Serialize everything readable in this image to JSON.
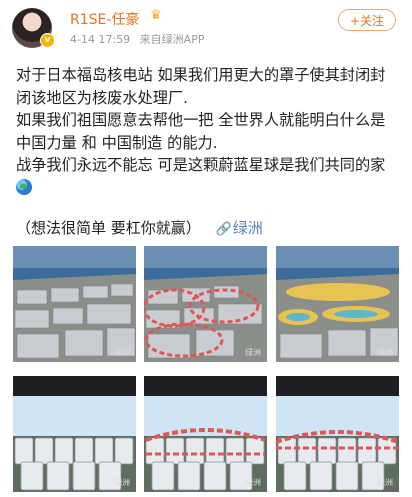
{
  "user": {
    "name": "R1SE-任豪",
    "vip_icon": "crown-icon",
    "avatar_badge": "v",
    "time": "4-14 17:59",
    "source": "来自绿洲APP"
  },
  "follow_label": "+关注",
  "post": {
    "line1": "对于日本福岛核电站 如果我们用更大的罩子使其封闭封闭该地区为核废水处理厂.",
    "line2": "如果我们祖国愿意去帮他一把 全世界人就能明白什么是中国力量 和 中国制造 的能力.",
    "line3": "战争我们永远不能忘 可是这颗蔚蓝星球是我们共同的家",
    "emoji": "globe-icon",
    "footer": "（想法很简单 要杠你就赢）",
    "link_label": "绿洲",
    "link_icon": "link-icon"
  },
  "images": [
    {
      "kind": "aerial",
      "overlay": "none",
      "watermark": "绿洲"
    },
    {
      "kind": "aerial",
      "overlay": "red-dome",
      "watermark": "绿洲"
    },
    {
      "kind": "aerial",
      "overlay": "yellow-dome",
      "watermark": "绿洲"
    },
    {
      "kind": "tanks",
      "overlay": "none",
      "watermark": "绿洲"
    },
    {
      "kind": "tanks",
      "overlay": "red-dome",
      "watermark": "绿洲"
    },
    {
      "kind": "tanks",
      "overlay": "red-dome",
      "watermark": "绿洲"
    }
  ],
  "colors": {
    "username": "#e8721c",
    "link": "#5b7fb8",
    "meta": "#999999",
    "dome_red": "#e05555",
    "dome_yellow": "#f2c94c"
  }
}
